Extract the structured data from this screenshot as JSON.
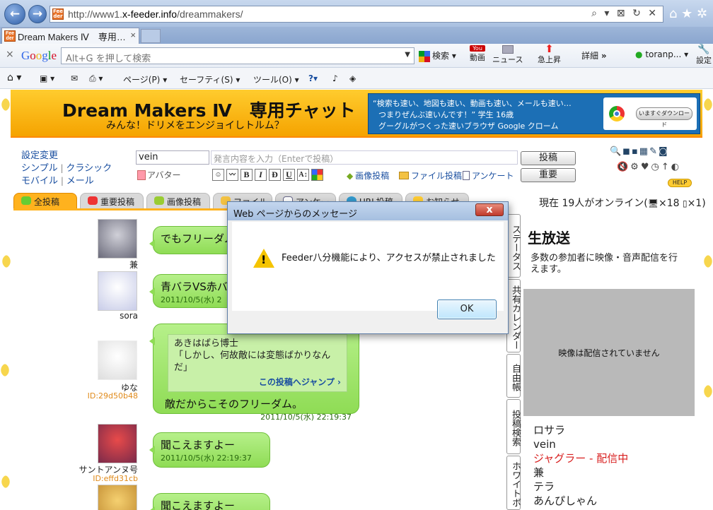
{
  "browser": {
    "url_prefix": "http://www1.",
    "url_domain": "x-feeder.info",
    "url_path": "/dreammakers/",
    "addr_icons": "⌕ ▾ ⊠ ↻ ✕",
    "top_icons": "⌂ ★ ✲",
    "favicon_text": "Fee der",
    "tab_title": "Dream Makers Ⅳ　専用…",
    "tab_close": "×"
  },
  "google_bar": {
    "close": "×",
    "logo": "Google",
    "search_placeholder": "Alt+G を押して検索",
    "search_btn": "検索",
    "video_top": "You",
    "video": "動画",
    "news": "ニュース",
    "trend": "急上昇",
    "details": "詳細",
    "more": "»",
    "user": "toranp...",
    "settings": "設定"
  },
  "command_bar": {
    "page": "ページ(P)",
    "safety": "セーフティ(S)",
    "tools": "ツール(O)"
  },
  "site": {
    "title": "Dream Makers Ⅳ　専用チャット",
    "subtitle": "みんな！ドリメをエンジョイしトルム？",
    "ad_line1": "“検索も速い、地図も速い、動画も速い、メールも速い…",
    "ad_line2": "つまりぜんぶ速いんです！” 学生 16歳",
    "ad_line3": "グーグルがつくった速いブラウザ Google クローム",
    "ad_button": "いますぐダウンロード"
  },
  "menu": {
    "settings": "設定変更",
    "simple": "シンプル",
    "classic": "クラシック",
    "mobile": "モバイル",
    "mail": "メール",
    "sep": "|"
  },
  "composer": {
    "name_value": "vein",
    "msg_placeholder": "発言内容を入力（Enterで投稿）",
    "post_btn": "投稿",
    "important_btn": "重要",
    "avatar_label": "アバター",
    "image_post": "画像投稿",
    "file_post": "ファイル投稿",
    "survey": "アンケート",
    "fmt_b": "B",
    "fmt_i": "I",
    "fmt_d": "Đ",
    "fmt_u": "U",
    "fmt_a": "A↕",
    "help": "HELP"
  },
  "tabs": [
    {
      "label": "全投稿",
      "active": true
    },
    {
      "label": "重要投稿"
    },
    {
      "label": "画像投稿"
    },
    {
      "label": "ファイル"
    },
    {
      "label": "アンケート"
    },
    {
      "label": "URL投稿"
    },
    {
      "label": "お知らせ"
    }
  ],
  "online": {
    "text": "現在 19人がオンライン(",
    "pc": "×18",
    "mobile": "×1)"
  },
  "messages": [
    {
      "user": "兼",
      "text": "でもフリーダム",
      "time": ""
    },
    {
      "user": "sora",
      "text": "青バラVS赤バ",
      "time": "2011/10/5(水) 2"
    },
    {
      "user": "ゆな",
      "id": "ID:29d50b48",
      "quote_user": "あきはばら博士",
      "quote_text": "「しかし、何故敵には変態ばかりなんだ」",
      "quote_jump": "この投稿へジャンプ ›",
      "text": "敵だからこそのフリーダム。",
      "time": "2011/10/5(水) 22:19:37"
    },
    {
      "user": "サントアンヌ号",
      "id": "ID:effd31cb",
      "text": "聞こえますよー",
      "time": "2011/10/5(水) 22:19:37"
    },
    {
      "user": "",
      "text": "聞こえますよー",
      "time": ""
    }
  ],
  "side_tabs": [
    "ステータス",
    "共有カレンダー",
    "自由帳",
    "投稿検索",
    "ホワイトボ"
  ],
  "live": {
    "title": "生放送",
    "desc": "多数の参加者に映像・音声配信を行えます。",
    "no_video": "映像は配信されていません",
    "users": [
      "ロサラ",
      "vein",
      "ジャグラー - 配信中",
      "兼",
      "テラ",
      "あんぴしゃん"
    ]
  },
  "dialog": {
    "title": "Web ページからのメッセージ",
    "close": "x",
    "message": "Feeder八分機能により、アクセスが禁止されました",
    "ok": "OK",
    "warn_mark": "!"
  }
}
